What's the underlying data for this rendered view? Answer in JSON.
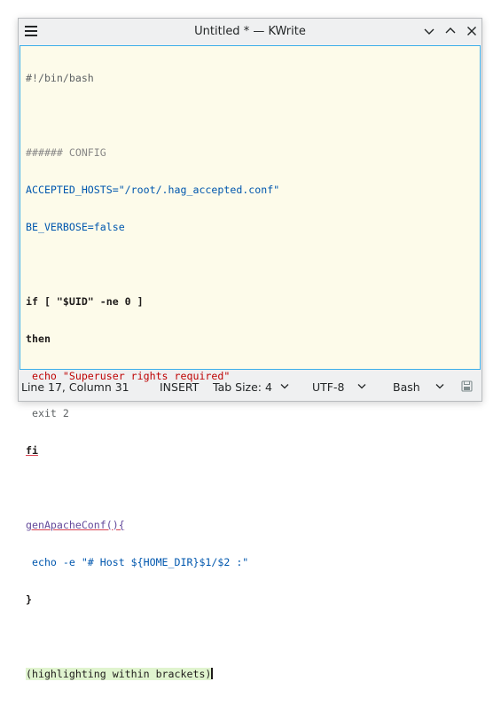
{
  "window": {
    "title": "Untitled * — KWrite"
  },
  "editor": {
    "lines": [
      "#!/bin/bash",
      "",
      "###### CONFIG",
      "ACCEPTED_HOSTS=\"/root/.hag_accepted.conf\"",
      "BE_VERBOSE=false",
      "",
      "if [ \"$UID\" -ne 0 ]",
      "then",
      " echo \"Superuser rights required\"",
      " exit 2",
      "fi",
      "",
      "genApacheConf(){",
      " echo -e \"# Host ${HOME_DIR}$1/$2 :\"",
      "}",
      "",
      "(highlighting within brackets)"
    ]
  },
  "statusbar": {
    "position": "Line 17, Column 31",
    "mode": "INSERT",
    "tab_size": "Tab Size: 4",
    "encoding": "UTF-8",
    "syntax": "Bash"
  },
  "colors": {
    "editor_bg": "#fdfbea",
    "focus_border": "#3daee9",
    "string": "#bf0303",
    "variable": "#0057ae",
    "function": "#644a9b",
    "comment": "#898887"
  },
  "icons": [
    "hamburger-menu-icon",
    "minimize-icon",
    "maximize-icon",
    "close-icon",
    "save-icon",
    "chevron-down-icon"
  ]
}
